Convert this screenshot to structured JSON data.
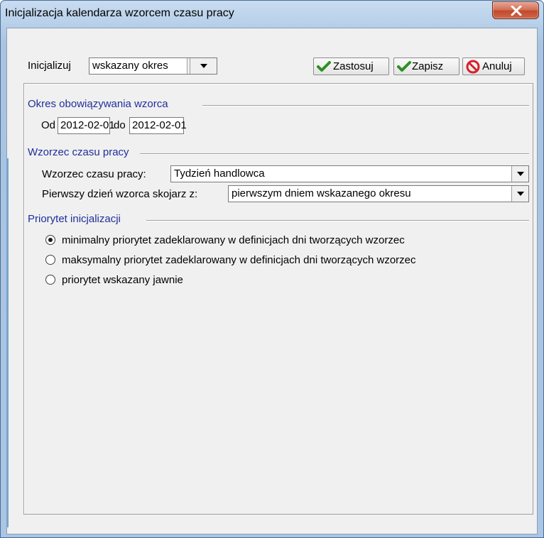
{
  "window": {
    "title": "Inicjalizacja kalendarza wzorcem czasu pracy",
    "close_symbol": "x"
  },
  "toolbar": {
    "init_label": "Inicjalizuj",
    "init_value": "wskazany okres",
    "apply_label": "Zastosuj",
    "save_label": "Zapisz",
    "cancel_label": "Anuluj"
  },
  "period": {
    "title": "Okres obowiązywania wzorca",
    "from_label": "Od",
    "from_value": "2012-02-01",
    "to_label": "do",
    "to_value": "2012-02-01"
  },
  "pattern": {
    "title": "Wzorzec czasu pracy",
    "pattern_label": "Wzorzec czasu pracy:",
    "pattern_value": "Tydzień handlowca",
    "first_day_label": "Pierwszy dzień wzorca skojarz z:",
    "first_day_value": "pierwszym dniem wskazanego okresu"
  },
  "priority": {
    "title": "Priorytet inicjalizacji",
    "options": [
      {
        "label": "minimalny priorytet zadeklarowany w definicjach dni tworzących wzorzec",
        "selected": true
      },
      {
        "label": "maksymalny priorytet zadeklarowany w definicjach dni tworzących wzorzec",
        "selected": false
      },
      {
        "label": "priorytet wskazany jawnie",
        "selected": false
      }
    ]
  },
  "icons": {
    "check": "check-icon",
    "cancel": "no-entry-icon",
    "dropdown": "dropdown-arrow-icon"
  },
  "colors": {
    "group_title": "#1f2f9c",
    "close_button": "#c24a2b",
    "check_green": "#3aa12c",
    "cancel_red": "#d6202b"
  }
}
